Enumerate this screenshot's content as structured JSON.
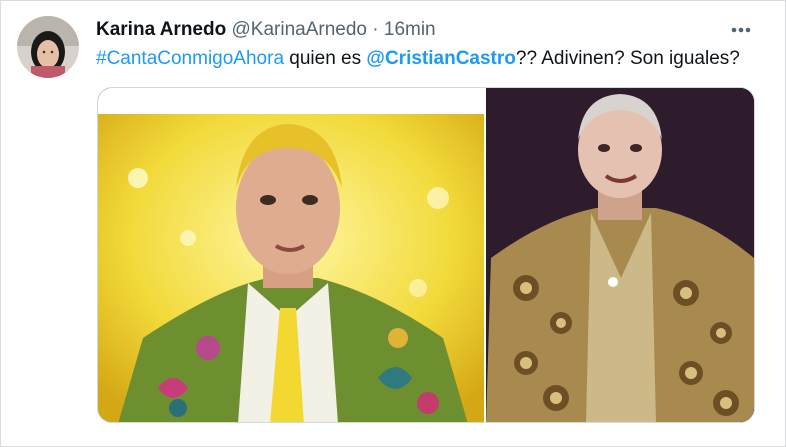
{
  "tweet": {
    "author_name": "Karina Arnedo",
    "author_handle": "@KarinaArnedo",
    "separator": "·",
    "time": "16min",
    "more_icon": "more-horizontal-icon",
    "text_hashtag": "#CantaConmigoAhora",
    "text_part1": " quien es ",
    "text_mention": "@CristianCastro",
    "text_part2": "?? Adivinen? Son iguales?"
  },
  "colors": {
    "link": "#1d9bf0",
    "secondary_text": "#536471",
    "primary_text": "#0f1419"
  }
}
